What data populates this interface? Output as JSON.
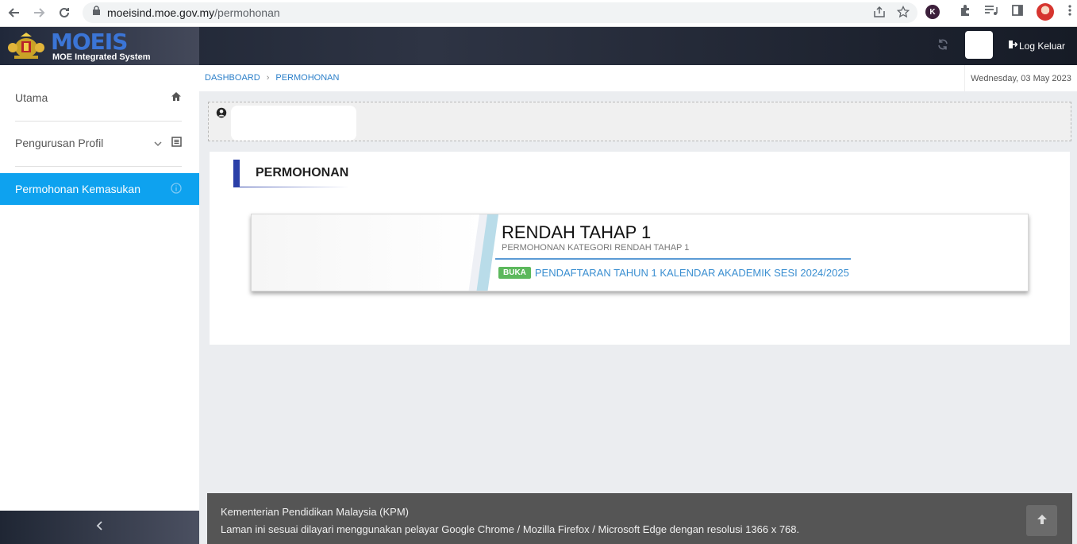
{
  "browser": {
    "url_host": "moeisind.moe.gov.my",
    "url_path": "/permohonan",
    "extension_letter": "K"
  },
  "header": {
    "logo_text": "MOEIS",
    "logo_subtitle": "MOE Integrated System",
    "logout_label": "Log Keluar"
  },
  "sidebar": {
    "items": [
      {
        "label": "Utama",
        "icon": "home-icon"
      },
      {
        "label": "Pengurusan Profil",
        "icon": "profile-list-icon"
      },
      {
        "label": "Permohonan Kemasukan",
        "icon": "info-icon"
      }
    ],
    "collapse_icon": "chevron-left-icon"
  },
  "breadcrumb": {
    "items": [
      "DASHBOARD",
      "PERMOHONAN"
    ],
    "separator": "›"
  },
  "date": "Wednesday, 03 May 2023",
  "main": {
    "section_title": "PERMOHONAN",
    "tile": {
      "title": "RENDAH TAHAP 1",
      "subtitle": "PERMOHONAN KATEGORI RENDAH TAHAP 1",
      "badge": "BUKA",
      "link": "PENDAFTARAN TAHUN 1 KALENDAR AKADEMIK SESI 2024/2025"
    }
  },
  "footer": {
    "line1": "Kementerian Pendidikan Malaysia (KPM)",
    "line2": "Laman ini sesuai dilayari menggunakan pelayar Google Chrome / Mozilla Firefox / Microsoft Edge dengan resolusi 1366 x 768."
  },
  "colors": {
    "accent": "#0ea2ef",
    "badge": "#5cb85c",
    "link": "#3b8fd1",
    "section_bar": "#2a3fa8"
  }
}
